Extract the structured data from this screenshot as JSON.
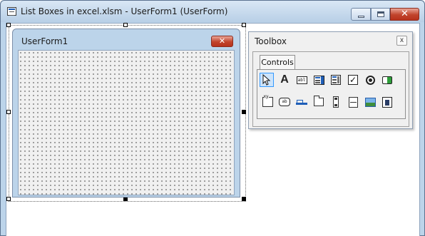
{
  "window": {
    "title": "List Boxes in excel.xlsm - UserForm1 (UserForm)",
    "buttons": {
      "minimize": "minimize",
      "maximize": "maximize",
      "close": "✕"
    }
  },
  "userform": {
    "title": "UserForm1",
    "close": "✕"
  },
  "toolbox": {
    "title": "Toolbox",
    "close": "x",
    "tabs": [
      {
        "label": "Controls"
      }
    ],
    "tools_row1": [
      {
        "name": "select-objects-icon",
        "selected": true
      },
      {
        "name": "label-icon",
        "glyph": "A"
      },
      {
        "name": "textbox-icon",
        "glyph": "abl"
      },
      {
        "name": "combobox-icon"
      },
      {
        "name": "listbox-icon"
      },
      {
        "name": "checkbox-icon",
        "glyph": "✓"
      },
      {
        "name": "optionbutton-icon"
      },
      {
        "name": "togglebutton-icon"
      }
    ],
    "tools_row2": [
      {
        "name": "frame-icon",
        "glyph": "xy"
      },
      {
        "name": "commandbutton-icon",
        "glyph": "ab"
      },
      {
        "name": "tabstrip-icon"
      },
      {
        "name": "multipage-icon"
      },
      {
        "name": "scrollbar-icon"
      },
      {
        "name": "spinbutton-icon"
      },
      {
        "name": "image-icon"
      },
      {
        "name": "refedit-icon"
      }
    ]
  },
  "colors": {
    "chrome": "#bcd4ea",
    "close_red": "#c1432b",
    "selection_blue": "#3399ff"
  }
}
